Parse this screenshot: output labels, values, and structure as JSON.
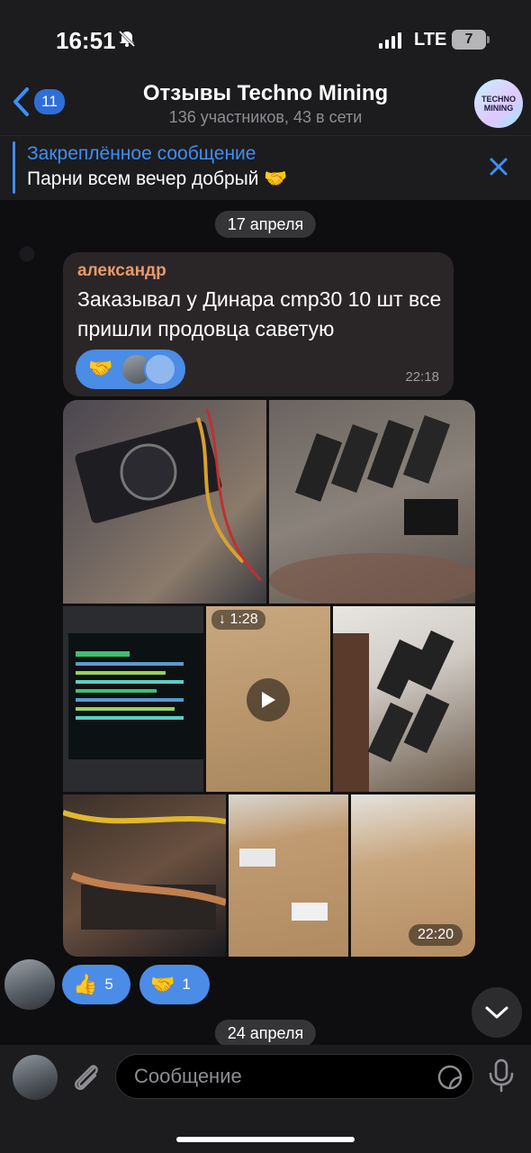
{
  "status_bar": {
    "time": "16:51",
    "network": "LTE",
    "battery": "7"
  },
  "header": {
    "back_count": "11",
    "title": "Отзывы Techno Mining",
    "subtitle": "136 участников, 43 в сети",
    "avatar_text_1": "TECHNO",
    "avatar_text_2": "MINING"
  },
  "pinned": {
    "title": "Закреплённое сообщение",
    "text": "Парни всем вечер добрый 🤝"
  },
  "chat": {
    "date_1": "17 апреля",
    "message": {
      "author": "александр",
      "text": "Заказывал у Динара cmp30 10 шт все пришли  продовца саветую",
      "reaction_emoji": "🤝",
      "time": "22:18"
    },
    "media": {
      "video_duration": "1:28",
      "time": "22:20"
    },
    "reactions": [
      {
        "emoji": "👍",
        "count": "5"
      },
      {
        "emoji": "🤝",
        "count": "1"
      }
    ],
    "date_2": "24 апреля"
  },
  "input": {
    "placeholder": "Сообщение"
  },
  "colors": {
    "accent": "#3e8ef7",
    "reaction": "#4a8ce6",
    "author": "#e89a6a"
  },
  "icons": [
    "back-chevron-icon",
    "bell-muted-icon",
    "close-icon",
    "play-icon",
    "download-icon",
    "chevron-down-icon",
    "paperclip-icon",
    "sticker-icon",
    "microphone-icon"
  ]
}
